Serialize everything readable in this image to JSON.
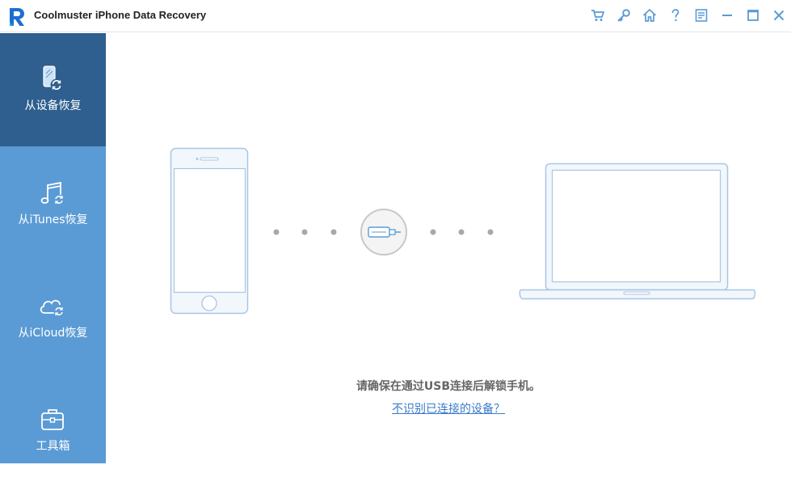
{
  "window": {
    "title": "Coolmuster iPhone Data Recovery",
    "logo_icon": "coolmuster-r-logo",
    "toolbar_icons": [
      "cart-icon",
      "key-icon",
      "home-icon",
      "help-icon",
      "feedback-icon",
      "minimize-icon",
      "maximize-icon",
      "close-icon"
    ]
  },
  "sidebar": {
    "items": [
      {
        "label": "从设备恢复",
        "icon": "phone-restore-icon",
        "active": true
      },
      {
        "label": "从iTunes恢复",
        "icon": "itunes-restore-icon",
        "active": false
      },
      {
        "label": "从iCloud恢复",
        "icon": "icloud-restore-icon",
        "active": false
      },
      {
        "label": "工具箱",
        "icon": "toolbox-icon",
        "active": false
      }
    ]
  },
  "main": {
    "instruction": "请确保在通过USB连接后解锁手机。",
    "help_link": "不识别已连接的设备？"
  },
  "colors": {
    "sidebar_bg": "#5b9bd5",
    "sidebar_active_bg": "#2e5f8e",
    "outline": "#a9c6e4",
    "device_fill": "#f2f7fc",
    "link": "#3a7bc8"
  }
}
